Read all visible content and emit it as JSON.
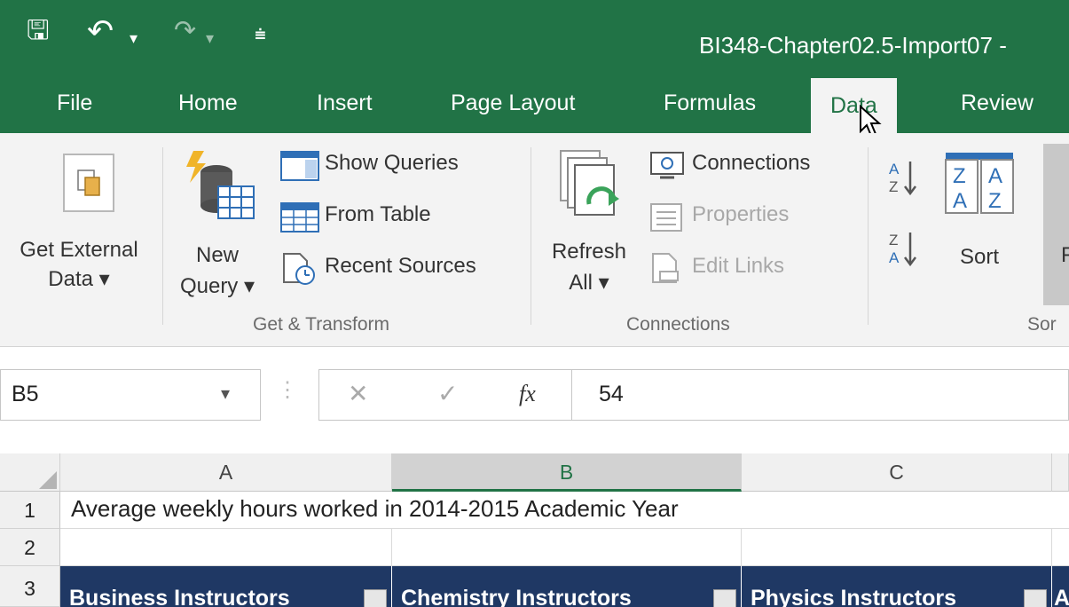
{
  "window": {
    "title": "BI348-Chapter02.5-Import07 -"
  },
  "qat": {
    "save_glyph": "🖫",
    "undo_glyph": "↶",
    "undo_drop": "▾",
    "redo_glyph": "↷",
    "redo_drop": "▾",
    "customize_glyph": "⩧"
  },
  "tabs": [
    {
      "label": "File"
    },
    {
      "label": "Home"
    },
    {
      "label": "Insert"
    },
    {
      "label": "Page Layout"
    },
    {
      "label": "Formulas"
    },
    {
      "label": "Data"
    },
    {
      "label": "Review"
    }
  ],
  "ribbon": {
    "get_external": {
      "line1": "Get External",
      "line2": "Data ▾"
    },
    "new_query": {
      "line1": "New",
      "line2": "Query ▾"
    },
    "show_queries": "Show Queries",
    "from_table": "From Table",
    "recent_sources": "Recent Sources",
    "group_get_transform": "Get & Transform",
    "refresh": {
      "line1": "Refresh",
      "line2": "All ▾"
    },
    "connections": "Connections",
    "properties": "Properties",
    "edit_links": "Edit Links",
    "group_connections": "Connections",
    "sort": "Sort",
    "group_sort_partial": "Sor",
    "filter_partial": "F"
  },
  "formula_bar": {
    "name_box": "B5",
    "name_drop": "▾",
    "cancel": "✕",
    "enter": "✓",
    "fx": "fx",
    "value": "54"
  },
  "grid": {
    "columns": [
      "A",
      "B",
      "C"
    ],
    "rows": [
      "1",
      "2",
      "3"
    ],
    "a1": "Average weekly hours worked in 2014-2015 Academic Year",
    "headers": [
      "Business Instructors",
      "Chemistry Instructors",
      "Physics Instructors",
      "A"
    ]
  },
  "colors": {
    "excel_green": "#217346",
    "header_fill": "#1f3864",
    "ribbon_bg": "#f3f3f3"
  }
}
